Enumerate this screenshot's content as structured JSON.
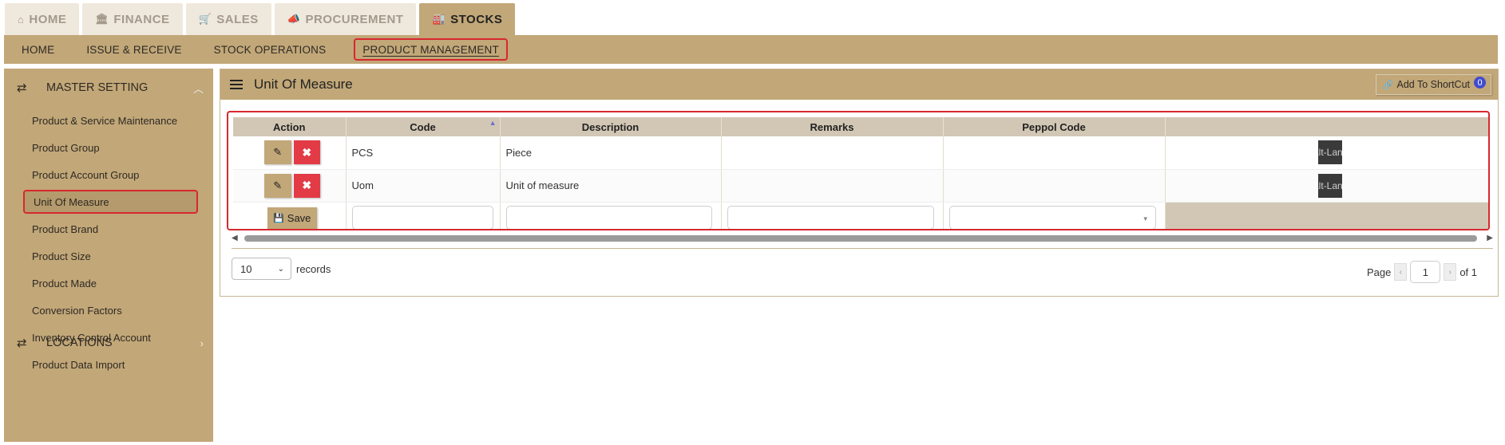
{
  "top_tabs": [
    {
      "label": "HOME",
      "icon": "home-icon",
      "glyph": "⌂"
    },
    {
      "label": "FINANCE",
      "icon": "bank-icon",
      "glyph": "🏛"
    },
    {
      "label": "SALES",
      "icon": "cart-icon",
      "glyph": "🛒"
    },
    {
      "label": "PROCUREMENT",
      "icon": "bullhorn-icon",
      "glyph": "📣"
    },
    {
      "label": "STOCKS",
      "icon": "industry-icon",
      "glyph": "🏭"
    }
  ],
  "sub_nav": [
    "HOME",
    "ISSUE & RECEIVE",
    "STOCK OPERATIONS",
    "PRODUCT MANAGEMENT"
  ],
  "sidebar": {
    "section_title": "MASTER SETTING",
    "items": [
      "Product & Service Maintenance",
      "Product Group",
      "Product Account Group",
      "Unit Of Measure",
      "Product Brand",
      "Product Size",
      "Product Made",
      "Conversion Factors",
      "Inventory Control Account",
      "Product Data Import"
    ],
    "section2_title": "LOCATIONS"
  },
  "panel": {
    "title": "Unit Of Measure",
    "shortcut_label": "Add To ShortCut",
    "shortcut_count": "0"
  },
  "grid": {
    "columns": [
      "Action",
      "Code",
      "Description",
      "Remarks",
      "Peppol Code",
      ""
    ],
    "rows": [
      {
        "code": "PCS",
        "description": "Piece",
        "remarks": "",
        "peppol": "",
        "lang": "Alt-Lang"
      },
      {
        "code": "Uom",
        "description": "Unit of measure",
        "remarks": "",
        "peppol": "",
        "lang": "Alt-Lang"
      }
    ],
    "save_label": "Save"
  },
  "footer": {
    "page_size": "10",
    "records_label": "records",
    "page_label": "Page",
    "page_value": "1",
    "of_label": "of 1"
  },
  "colors": {
    "accent": "#c2a778",
    "highlight": "#d7282f",
    "delete": "#e23b46"
  }
}
